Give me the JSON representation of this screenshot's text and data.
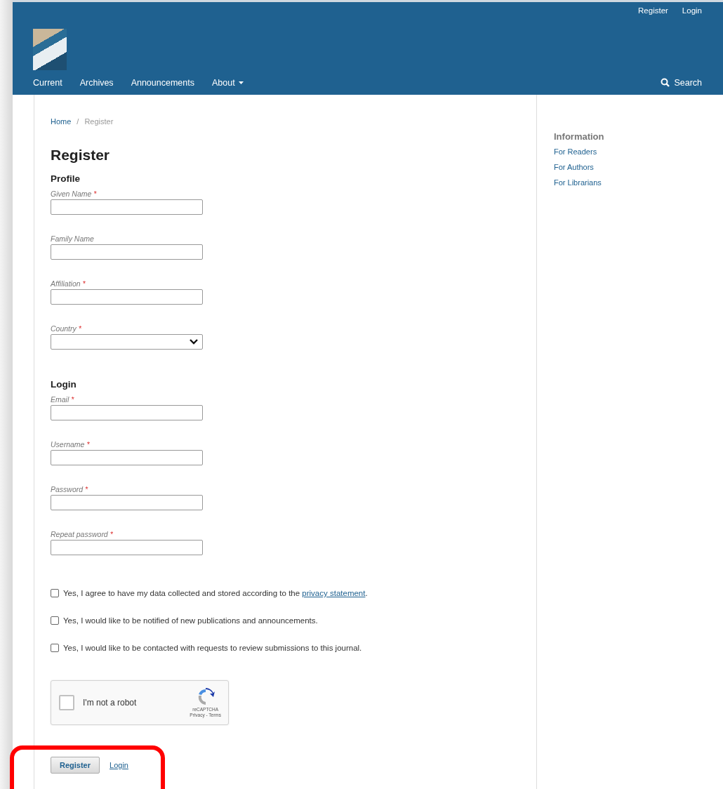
{
  "header": {
    "user_links": [
      "Register",
      "Login"
    ],
    "nav": [
      {
        "label": "Current",
        "has_menu": false
      },
      {
        "label": "Archives",
        "has_menu": false
      },
      {
        "label": "Announcements",
        "has_menu": false
      },
      {
        "label": "About",
        "has_menu": true
      }
    ],
    "search": "Search"
  },
  "breadcrumb": {
    "items": [
      "Home"
    ],
    "separator": "/",
    "current": "Register"
  },
  "title": "Register",
  "sections": [
    {
      "heading": "Profile",
      "fields": [
        {
          "label": "Given Name",
          "required": true,
          "kind": "text"
        },
        {
          "label": "Family Name",
          "required": false,
          "kind": "text"
        },
        {
          "label": "Affiliation",
          "required": true,
          "kind": "text"
        },
        {
          "label": "Country",
          "required": true,
          "kind": "select"
        }
      ]
    },
    {
      "heading": "Login",
      "fields": [
        {
          "label": "Email",
          "required": true,
          "kind": "text"
        },
        {
          "label": "Username",
          "required": true,
          "kind": "text"
        },
        {
          "label": "Password",
          "required": true,
          "kind": "text"
        },
        {
          "label": "Repeat password",
          "required": true,
          "kind": "text"
        }
      ]
    }
  ],
  "required_mark": "*",
  "consents": [
    {
      "text": "Yes, I agree to have my data collected and stored according to the ",
      "link": "privacy statement",
      "after": ".",
      "checked": false
    },
    {
      "text": "Yes, I would like to be notified of new publications and announcements.",
      "checked": false
    },
    {
      "text": "Yes, I would like to be contacted with requests to review submissions to this journal.",
      "checked": false
    }
  ],
  "captcha": {
    "label": "I'm not a robot",
    "checked": false,
    "brand": "reCAPTCHA",
    "links": "Privacy - Terms"
  },
  "actions": {
    "submit": "Register",
    "link": "Login"
  },
  "sidebar": {
    "title": "Information",
    "links": [
      "For Readers",
      "For Authors",
      "For Librarians"
    ]
  }
}
